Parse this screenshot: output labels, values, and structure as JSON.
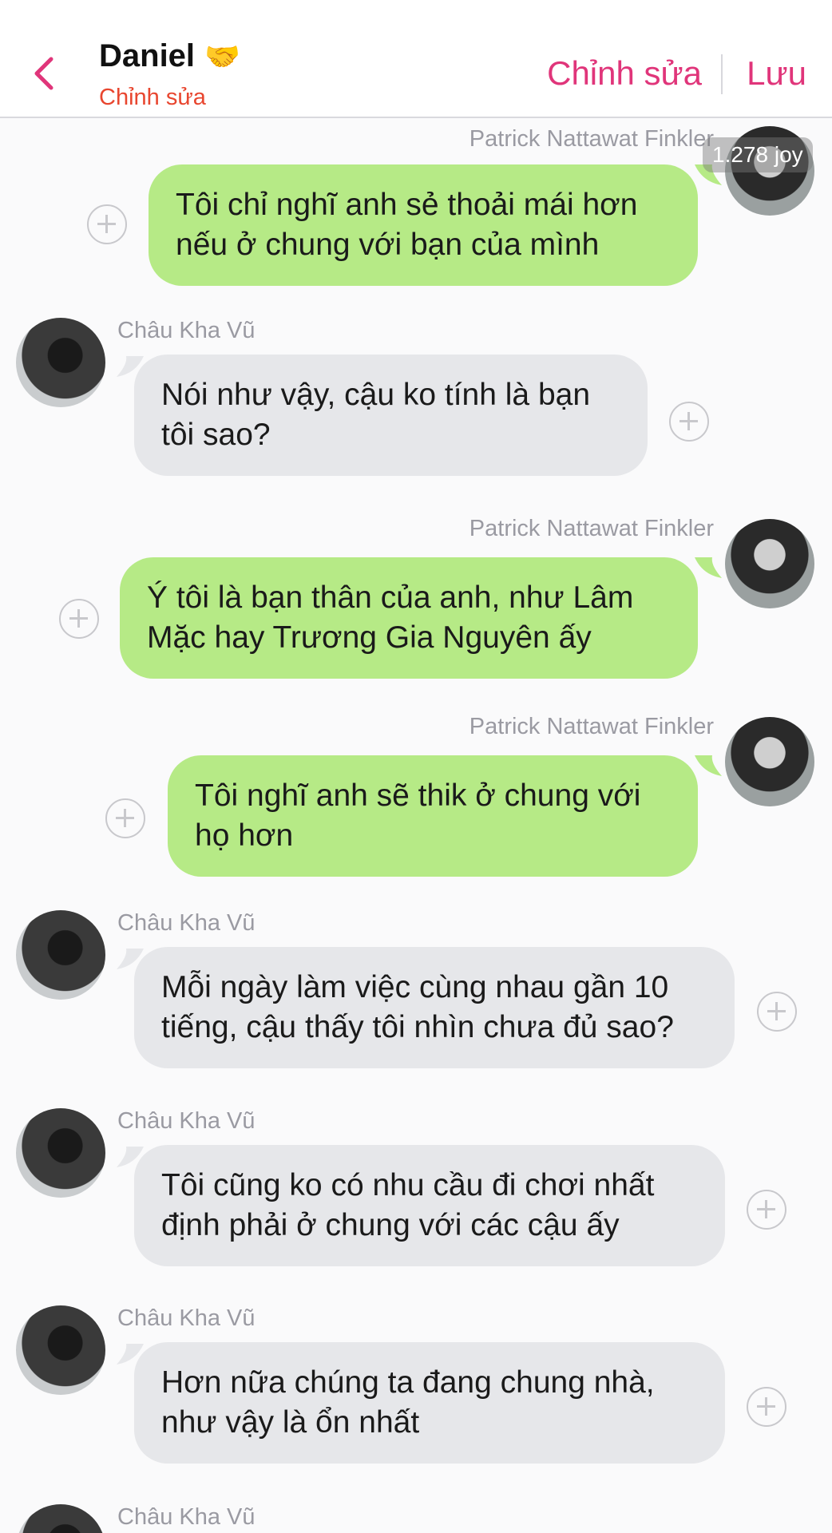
{
  "header": {
    "title": "Daniel",
    "emoji": "🤝",
    "subtitle": "Chỉnh sửa",
    "edit_label": "Chỉnh sửa",
    "save_label": "Lưu",
    "accent": "#e0357a"
  },
  "joy_badge": "1.278 joy",
  "messages": [
    {
      "sender": "Patrick Nattawat Finkler",
      "side": "right",
      "text": "Tôi chỉ nghĩ anh sẻ thoải mái hơn nếu ở chung với bạn của mình"
    },
    {
      "sender": "Châu Kha Vũ",
      "side": "left",
      "text": "Nói như vậy, cậu ko tính là bạn tôi sao?"
    },
    {
      "sender": "Patrick Nattawat Finkler",
      "side": "right",
      "text": "Ý tôi là bạn thân của anh, như Lâm Mặc hay Trương Gia Nguyên ấy"
    },
    {
      "sender": "Patrick Nattawat Finkler",
      "side": "right",
      "text": "Tôi nghĩ anh sẽ thik ở chung với họ hơn"
    },
    {
      "sender": "Châu Kha Vũ",
      "side": "left",
      "text": "Mỗi ngày làm việc cùng nhau gần 10 tiếng, cậu thấy tôi nhìn chưa đủ sao?"
    },
    {
      "sender": "Châu Kha Vũ",
      "side": "left",
      "text": "Tôi cũng ko có nhu cầu đi chơi nhất định phải ở chung với các cậu ấy"
    },
    {
      "sender": "Châu Kha Vũ",
      "side": "left",
      "text": "Hơn nữa chúng ta đang chung nhà, như vậy là ổn nhất"
    },
    {
      "sender": "Châu Kha Vũ",
      "side": "left",
      "text": ""
    }
  ]
}
